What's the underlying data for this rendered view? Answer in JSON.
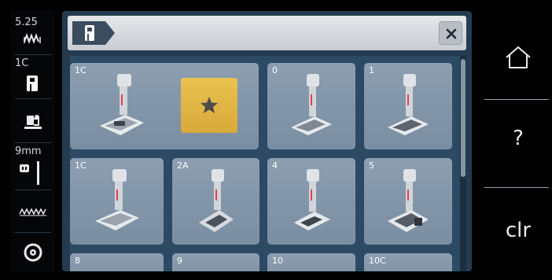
{
  "left_status": {
    "stitch_width": "5.25",
    "presser_foot": "1C",
    "needle_size": "9mm"
  },
  "grid": {
    "tiles": [
      {
        "label": "1C",
        "favorite": true
      },
      {
        "label": "0"
      },
      {
        "label": "1"
      },
      {
        "label": "1C"
      },
      {
        "label": "2A"
      },
      {
        "label": "4"
      },
      {
        "label": "5"
      },
      {
        "label": "8"
      },
      {
        "label": "9"
      },
      {
        "label": "10"
      },
      {
        "label": "10C"
      }
    ]
  },
  "right_bar": {
    "home_icon": "home-icon",
    "help_label": "?",
    "clear_label": "clr"
  },
  "colors": {
    "favorite_star": "#d9ae3b",
    "tile": "#8598ab",
    "dialog_bg": "#243b50"
  }
}
